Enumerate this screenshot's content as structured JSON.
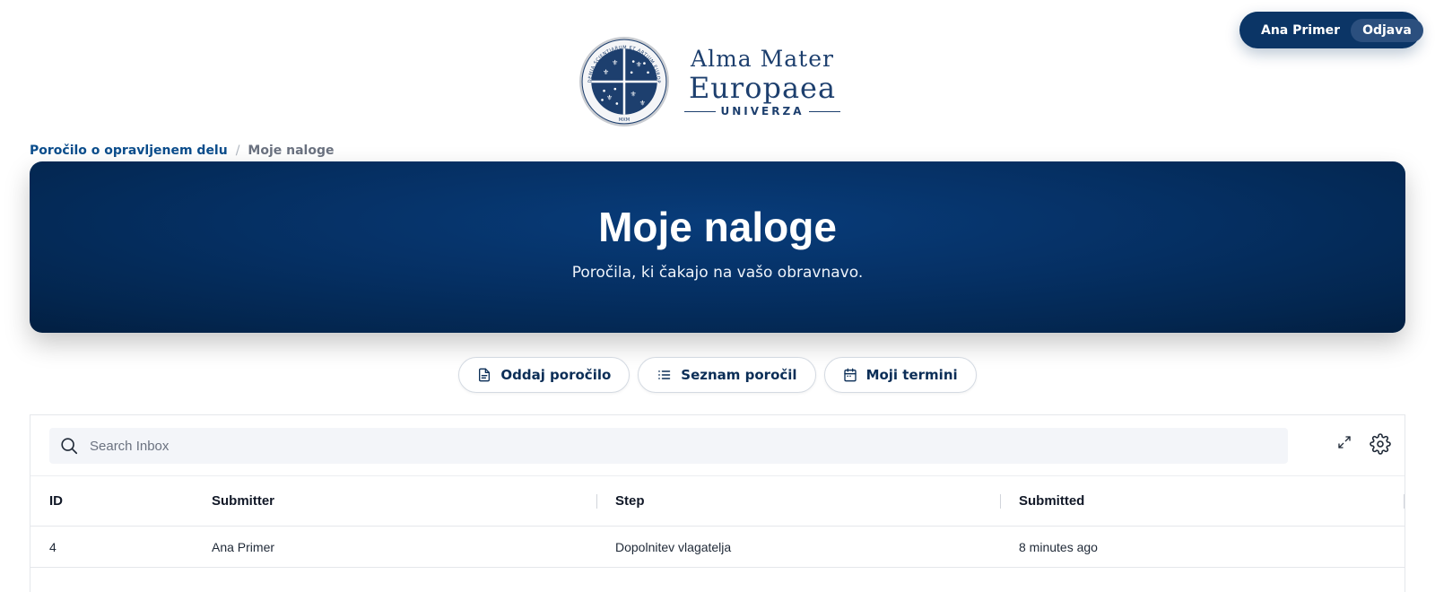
{
  "user": {
    "name": "Ana Primer",
    "logout_label": "Odjava"
  },
  "logo": {
    "line1": "Alma Mater",
    "line2": "Europaea",
    "line3": "UNIVERZA",
    "seal_text": "ACADEMIA SCIENTIARUM ET ARTIUM EUROPAEA",
    "seal_year": "MXM"
  },
  "breadcrumb": {
    "parent": "Poročilo o opravljenem delu",
    "current": "Moje naloge"
  },
  "hero": {
    "title": "Moje naloge",
    "subtitle": "Poročila, ki čakajo na vašo obravnavo."
  },
  "nav": {
    "submit_label": "Oddaj poročilo",
    "list_label": "Seznam poročil",
    "appointments_label": "Moji termini"
  },
  "inbox": {
    "search_placeholder": "Search Inbox",
    "columns": [
      "ID",
      "Submitter",
      "Step",
      "Submitted"
    ],
    "rows": [
      {
        "id": "4",
        "submitter": "Ana Primer",
        "step": "Dopolnitev vlagatelja",
        "submitted": "8 minutes ago"
      }
    ]
  },
  "colors": {
    "brand_navy": "#0b3566",
    "online_dot": "#34c77b",
    "hero_dark": "#021c3c"
  }
}
